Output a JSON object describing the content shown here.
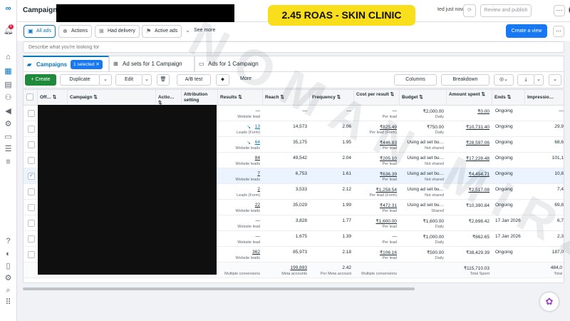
{
  "title": "Campaigns",
  "overlay_text": "2.45 ROAS - SKIN CLINIC",
  "watermark_text": "NOMAN MIRZA",
  "updated_text": "ted just now",
  "review_label": "Review and publish",
  "dots_label": "···",
  "notif_count": "6",
  "filters": {
    "all_ads": "All ads",
    "actions": "Actions",
    "had_delivery": "Had delivery",
    "active_ads": "Active ads",
    "see_more": "See more",
    "create_view": "Create a view"
  },
  "search_placeholder": "Describe what you're looking for",
  "tabs": {
    "campaigns": "Campaigns",
    "selected": "1 selected  ✕",
    "adsets": "Ad sets for 1 Campaign",
    "ads": "Ads for 1 Campaign"
  },
  "toolbar": {
    "create": "+ Create",
    "duplicate": "Duplicate",
    "edit": "Edit",
    "ab_test": "A/B test",
    "more": "More",
    "columns": "Columns",
    "breakdown": "Breakdown"
  },
  "headers": {
    "off_on": "Off…",
    "campaign": "Campaign",
    "actions": "Actio…",
    "attribution": "Attribution setting",
    "results": "Results",
    "reach": "Reach",
    "frequency": "Frequency",
    "cost_per_result": "Cost per result",
    "budget": "Budget",
    "amount_spent": "Amount spent",
    "ends": "Ends",
    "impressions": "Impressio…"
  },
  "rows": [
    {
      "results": "—",
      "results_sub": "Website lead",
      "results_link": false,
      "reach": "—",
      "freq": "—",
      "cpr": "—",
      "cpr_sub": "Per lead",
      "budget": "₹2,000.00",
      "budget_sub": "Daily",
      "spent": "₹0.00",
      "spent_ul": true,
      "ends": "Ongoing",
      "impr": "—"
    },
    {
      "results": "13",
      "results_sub": "Leads (Form)",
      "results_link": true,
      "reach": "14,573",
      "freq": "2.06",
      "cpr": "₹825.49",
      "cpr_sub": "Per lead (Form)",
      "budget": "₹750.00",
      "budget_sub": "Daily",
      "spent": "₹10,731.40",
      "spent_ul": true,
      "ends": "Ongoing",
      "impr": "29,9"
    },
    {
      "results": "64",
      "results_sub": "Website leads",
      "results_link": true,
      "reach": "35,175",
      "freq": "1.95",
      "cpr": "₹446.83",
      "cpr_sub": "Per lead",
      "budget": "Using ad set bu…",
      "budget_sub": "Not shared",
      "spent": "₹28,597.06",
      "spent_ul": true,
      "ends": "Ongoing",
      "impr": "68,6"
    },
    {
      "results": "84",
      "results_sub": "Website leads",
      "results_link": false,
      "reach": "49,542",
      "freq": "2.04",
      "cpr": "₹205.10",
      "cpr_sub": "Per lead",
      "budget": "Using ad set bu…",
      "budget_sub": "Not shared",
      "spent": "₹17,228.48",
      "spent_ul": true,
      "ends": "Ongoing",
      "impr": "101,1"
    },
    {
      "results": "7",
      "results_sub": "Website leads",
      "results_link": false,
      "reach": "6,753",
      "freq": "1.61",
      "cpr": "₹636.39",
      "cpr_sub": "Per lead",
      "budget": "Using ad set bu…",
      "budget_sub": "Not shared",
      "spent": "₹4,454.71",
      "spent_ul": true,
      "ends": "Ongoing",
      "impr": "10,8"
    },
    {
      "results": "2",
      "results_sub": "Leads (Form)",
      "results_link": false,
      "reach": "3,533",
      "freq": "2.12",
      "cpr": "₹1,258.54",
      "cpr_sub": "Per lead (Form)",
      "budget": "Using ad set bu…",
      "budget_sub": "Not shared",
      "spent": "₹2,517.08",
      "spent_ul": true,
      "ends": "Ongoing",
      "impr": "7,4"
    },
    {
      "results": "22",
      "results_sub": "Website leads",
      "results_link": false,
      "reach": "35,029",
      "freq": "1.99",
      "cpr": "₹472.31",
      "cpr_sub": "Per lead",
      "budget": "Using ad set bu…",
      "budget_sub": "Shared",
      "spent": "₹10,390.84",
      "spent_ul": false,
      "ends": "Ongoing",
      "impr": "69,8"
    },
    {
      "results": "—",
      "results_sub": "Website lead",
      "results_link": false,
      "reach": "3,828",
      "freq": "1.77",
      "cpr": "₹1,600.00",
      "cpr_sub": "Per lead",
      "budget": "₹1,600.00",
      "budget_sub": "Daily",
      "spent": "₹2,698.42",
      "spent_ul": false,
      "ends": "17 Jan 2026",
      "impr": "6,7"
    },
    {
      "results": "—",
      "results_sub": "Website lead",
      "results_link": false,
      "reach": "1,675",
      "freq": "1.39",
      "cpr": "—",
      "cpr_sub": "Per lead",
      "budget": "₹1,000.00",
      "budget_sub": "Daily",
      "spent": "₹662.65",
      "spent_ul": false,
      "ends": "17 Jan 2026",
      "impr": "2,3"
    },
    {
      "results": "362",
      "results_sub": "Website leads",
      "results_link": false,
      "reach": "85,973",
      "freq": "2.18",
      "cpr": "₹106.16",
      "cpr_sub": "Per lead",
      "budget": "₹500.00",
      "budget_sub": "Daily",
      "spent": "₹38,429.39",
      "spent_ul": false,
      "ends": "Ongoing",
      "impr": "187,0"
    }
  ],
  "totals": {
    "results_sub": "Multiple conversions",
    "reach": "199,893",
    "reach_sub": "Meta accounts",
    "freq": "2.42",
    "freq_sub": "Per Meta account",
    "cpr_sub": "Multiple conversions",
    "spent": "₹115,710.03",
    "spent_sub": "Total Spent",
    "impr": "484,0",
    "impr_sub": "Total"
  }
}
